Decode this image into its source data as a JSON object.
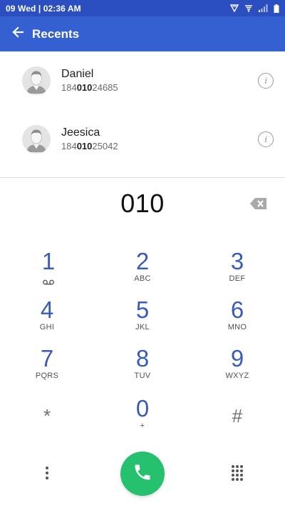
{
  "status_bar": {
    "time": "09 Wed | 02:36 AM",
    "icons": [
      "vpn-triangle-icon",
      "wifi-icon",
      "signal-icon",
      "battery-icon"
    ]
  },
  "app_bar": {
    "back_icon": "arrow-back-icon",
    "title": "Recents"
  },
  "recents": [
    {
      "name": "Daniel",
      "number_prefix": "184",
      "number_match": "010",
      "number_suffix": "24685"
    },
    {
      "name": "Jeesica",
      "number_prefix": "184",
      "number_match": "010",
      "number_suffix": "25042"
    }
  ],
  "dial_input": "010",
  "keypad": [
    {
      "digit": "1",
      "letters": ""
    },
    {
      "digit": "2",
      "letters": "ABC"
    },
    {
      "digit": "3",
      "letters": "DEF"
    },
    {
      "digit": "4",
      "letters": "GHI"
    },
    {
      "digit": "5",
      "letters": "JKL"
    },
    {
      "digit": "6",
      "letters": "MNO"
    },
    {
      "digit": "7",
      "letters": "PQRS"
    },
    {
      "digit": "8",
      "letters": "TUV"
    },
    {
      "digit": "9",
      "letters": "WXYZ"
    },
    {
      "digit": "*",
      "letters": ""
    },
    {
      "digit": "0",
      "letters": "+"
    },
    {
      "digit": "#",
      "letters": ""
    }
  ],
  "colors": {
    "status_bar": "#2b4fc0",
    "app_bar": "#3460d1",
    "keypad_digit": "#3a5cb8",
    "call_button": "#25c16f"
  }
}
